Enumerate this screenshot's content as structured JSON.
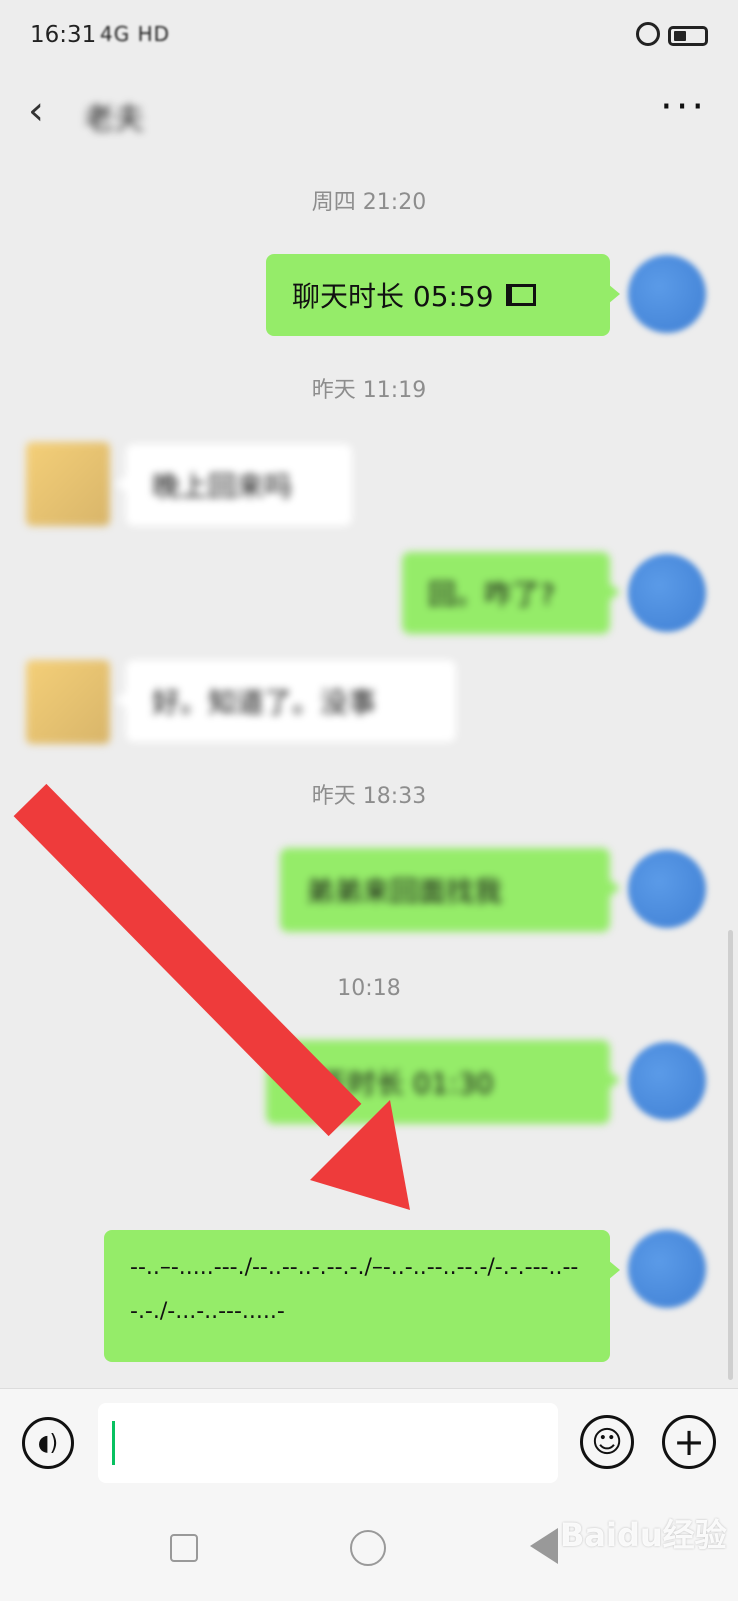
{
  "status": {
    "time": "16:31",
    "network": "4G HD"
  },
  "header": {
    "back": "‹",
    "title": "老夫",
    "more": "···"
  },
  "chat": {
    "ts1": "周四 21:20",
    "call_text": "聊天时长 05:59",
    "ts2": "昨天 11:19",
    "msg_in1": "晚上回来吗",
    "msg_out1": "回。咋了?",
    "msg_in2": "好。知道了。没事",
    "ts3": "昨天 18:33",
    "msg_out2": "弟弟来回面找我",
    "ts4": "10:18",
    "msg_out3": "聊天时长 01:30",
    "morse": "--..–-.....---./--..--..-.--.-./–-..-..--..--.-/-.-.---..---.-./-...-..---.....-"
  },
  "bottom": {
    "voice_icon": "voice-icon",
    "emoji_icon": "emoji-icon",
    "plus_icon": "plus-icon"
  },
  "watermark": "Baidu经验"
}
